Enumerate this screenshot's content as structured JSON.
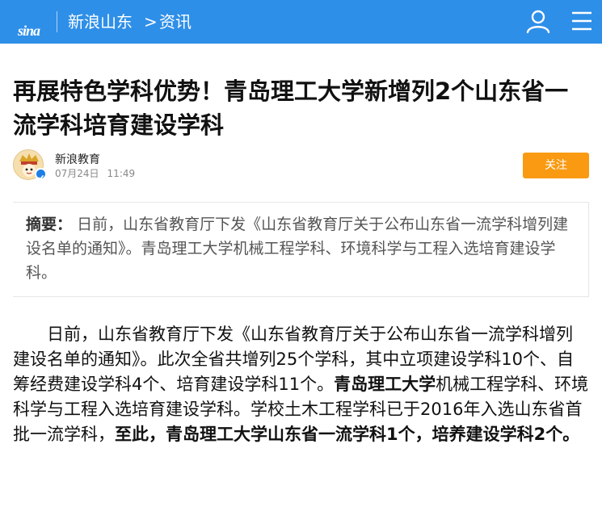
{
  "header": {
    "logo_text": "sina",
    "site": "新浪山东",
    "separator": ">",
    "section": "资讯",
    "bg_color": "#2e8fe8"
  },
  "article": {
    "title": "再展特色学科优势！青岛理工大学新增列2个山东省一流学科培育建设学科",
    "author": "新浪教育",
    "date": "07月24日",
    "time": "11:49",
    "follow_label": "关注",
    "summary_label": "摘要：",
    "summary": "日前，山东省教育厅下发《山东省教育厅关于公布山东省一流学科增列建设名单的通知》。青岛理工大学机械工程学科、环境科学与工程入选培育建设学科。",
    "body": {
      "p1_a": "日前，山东省教育厅下发《山东省教育厅关于公布山东省一流学科增列建设名单的通知》。此次全省共增列25个学科，其中立项建设学科10个、自筹经费建设学科4个、培育建设学科11个。",
      "p1_b": "青岛理工大学",
      "p1_c": "机械工程学科、环境科学与工程入选培育建设学科。学校土木工程学科已于2016年入选山东省首批一流学科，",
      "p1_d": "至此，青岛理工大学山东省一流学科1个，培养建设学科2个。"
    }
  },
  "colors": {
    "follow_button": "#f99a12",
    "verified_badge": "#1e7ee8"
  }
}
